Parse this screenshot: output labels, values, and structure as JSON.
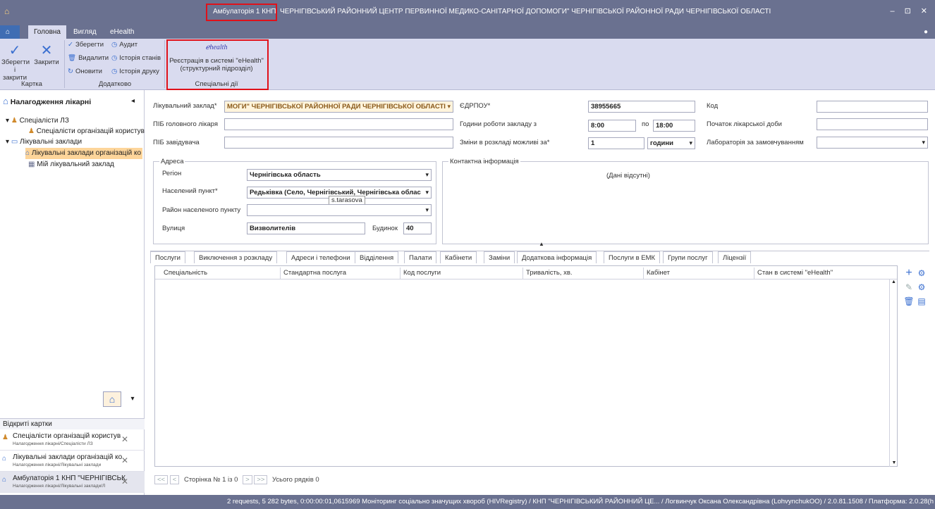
{
  "window": {
    "title_highlight": "Амбулаторія 1 КНП",
    "title_rest": "ЧЕРНІГІВСЬКИЙ РАЙОННИЙ ЦЕНТР ПЕРВИННОЇ МЕДИКО-САНІТАРНОЇ ДОПОМОГИ\" ЧЕРНІГІВСЬКОЇ РАЙОННОЇ РАДИ ЧЕРНІГІВСЬКОЇ ОБЛАСТІ",
    "controls": [
      "–",
      "⊡",
      "✕"
    ]
  },
  "ribbon_tabs": [
    "Головна",
    "Вигляд",
    "eHealth"
  ],
  "ribbon": {
    "save_close": "Зберегти і закрити",
    "close": "Закрити",
    "group_card": "Картка",
    "save": "Зберегти",
    "delete": "Видалити",
    "refresh": "Оновити",
    "audit": "Аудит",
    "state_history": "Історія станів",
    "print_history": "Історія друку",
    "group_extra": "Додатково",
    "ehealth_logo": "ℯhealth",
    "ehealth_reg": "Реєстрація в системі \"eHealth\" (структурний підрозділ)",
    "group_special": "Спеціальні дії"
  },
  "left": {
    "title": "Налагодження лікарні",
    "tree": [
      "Спеціалісти ЛЗ",
      "Спеціалісти організацій користув",
      "Лікувальні заклади",
      "Лікувальні заклади організацій ко",
      "Мій лікувальний заклад"
    ],
    "open_cards_title": "Відкриті картки",
    "open_cards": [
      {
        "title": "Спеціалісти організацій користув",
        "path": "Налагодження лікарні/Спеціалісти ЛЗ"
      },
      {
        "title": "Лікувальні заклади організацій ко",
        "path": "Налагодження лікарні/Лікувальні заклади"
      },
      {
        "title": "Амбулаторія 1 КНП \"ЧЕРНІГІВСЬК",
        "path": "Налагодження лікарні/Лікувальні заклади/Л"
      }
    ]
  },
  "form": {
    "facility_label": "Лікувальний заклад*",
    "facility_value": "МОГИ\" ЧЕРНІГІВСЬКОЇ РАЙОННОЇ РАДИ ЧЕРНІГІВСЬКОЇ ОБЛАСТІ",
    "edrpou_label": "ЄДРПОУ*",
    "edrpou_value": "38955665",
    "code_label": "Код",
    "code_value": "",
    "chief_label": "ПІБ головного лікаря",
    "chief_value": "",
    "hours_label": "Години роботи закладу з",
    "hours_from": "8:00",
    "hours_to_label": "по",
    "hours_to": "18:00",
    "daystart_label": "Початок лікарської доби",
    "daystart_value": "",
    "head_label": "ПІБ завідувача",
    "head_value": "",
    "shift_label": "Зміни в розкладі можливі за*",
    "shift_value": "1",
    "shift_unit": "години",
    "lab_label": "Лабораторія за замовчуванням",
    "lab_value": "",
    "address_title": "Адреса",
    "region_label": "Регіон",
    "region_value": "Чернігівська область",
    "locality_label": "Населений пункт*",
    "locality_value": "Редьківка (Село, Чернігівський, Чернігівська облас",
    "tooltip": "s.tarasova",
    "district_label": "Район населеного пункту",
    "district_value": "",
    "street_label": "Вулиця",
    "street_value": "Визволителів",
    "building_label": "Будинок",
    "building_value": "40",
    "contact_title": "Контактна інформація",
    "contact_empty": "(Дані відсутні)"
  },
  "detail_tabs": [
    "Послуги",
    "Виключення з розкладу",
    "Адреси і телефони",
    "Відділення",
    "Палати",
    "Кабінети",
    "Заміни",
    "Додаткова інформація",
    "Послуги в ЕМК",
    "Групи послуг",
    "Ліцензії"
  ],
  "grid_columns": [
    "Спеціальність",
    "Стандартна послуга",
    "Код послуги",
    "Тривалість, хв.",
    "Кабінет",
    "Стан в системі \"eHealth\""
  ],
  "pager": {
    "text": "Сторінка № 1 із 0",
    "rows": "Усього рядків 0"
  },
  "status": "2 requests, 5 282 bytes, 0:00:00:01,0615969  Моніторинг соціально значущих хвороб (HIVRegistry) / КНП \"ЧЕРНІГІВСЬКИЙ РАЙОННИЙ ЦЕ... / Логвинчук Оксана Олександрівна (LohvynchukOO) / 2.0.81.1508 / Платформа: 2.0.28(h"
}
